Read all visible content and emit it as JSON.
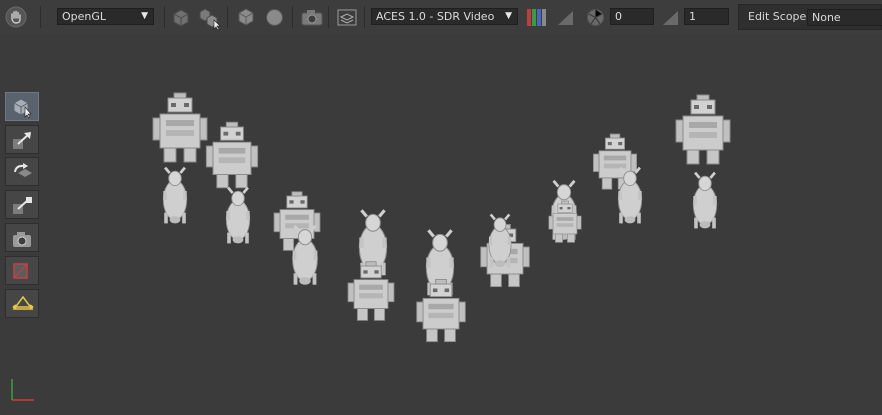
{
  "toolbar": {
    "renderer": {
      "value": "OpenGL"
    },
    "color_transform": {
      "value": "ACES 1.0 - SDR Video"
    },
    "exposure_value": "0",
    "gamma_value": "1",
    "edit_scope": {
      "label": "Edit Scope",
      "value": "None"
    }
  },
  "left_tools": [
    {
      "name": "selection-tool",
      "active": true
    },
    {
      "name": "translate-tool",
      "active": false
    },
    {
      "name": "rotate-tool",
      "active": false
    },
    {
      "name": "scale-tool",
      "active": false
    },
    {
      "name": "camera-tool",
      "active": false
    },
    {
      "name": "crop-tool",
      "active": false
    },
    {
      "name": "light-tool",
      "active": false
    }
  ],
  "colors": {
    "background": "#3b3b3b",
    "toolbar": "#3d3d3d",
    "active_tool": "#59626d",
    "model": "#c8c8c8",
    "axis_x": "#d23c3c",
    "axis_y": "#3ca03c",
    "light_tool": "#e6c84a"
  }
}
